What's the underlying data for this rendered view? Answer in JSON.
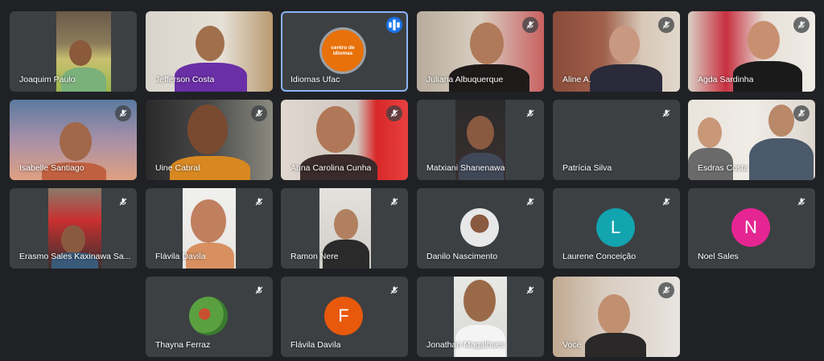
{
  "participants": [
    {
      "name": "Joaquim Paulo",
      "muted": true
    },
    {
      "name": "Jefferson Costa",
      "muted": false
    },
    {
      "name": "Idiomas Ufac",
      "muted": false,
      "speaking": true,
      "logo_text": "centro de idiomas"
    },
    {
      "name": "Juliana Albuquerque",
      "muted": true
    },
    {
      "name": "Aline A.",
      "muted": true
    },
    {
      "name": "Agda Sardinha",
      "muted": true
    },
    {
      "name": "Isabelle Santiago",
      "muted": true
    },
    {
      "name": "Uine Cabral",
      "muted": true
    },
    {
      "name": "Anna Carolina Cunha",
      "muted": true
    },
    {
      "name": "Matxiani Shanenawa",
      "muted": true
    },
    {
      "name": "Patrícia Silva",
      "muted": true
    },
    {
      "name": "Esdras Costa",
      "muted": true
    },
    {
      "name": "Erasmo Sales Kaxinawa Sa...",
      "muted": true
    },
    {
      "name": "Flávila Davila",
      "muted": true
    },
    {
      "name": "Ramon Nere",
      "muted": true
    },
    {
      "name": "Danilo Nascimento",
      "muted": true
    },
    {
      "name": "Laurene Conceição",
      "muted": true,
      "avatar_letter": "L",
      "avatar_color": "#12a4af"
    },
    {
      "name": "Noel Sales",
      "muted": true,
      "avatar_letter": "N",
      "avatar_color": "#e52592"
    },
    {
      "name": "Thayna Ferraz",
      "muted": true
    },
    {
      "name": "Flávila Davila",
      "muted": true,
      "avatar_letter": "F",
      "avatar_color": "#e8590c"
    },
    {
      "name": "Jonathan Magalhaes",
      "muted": true
    },
    {
      "name": "Você",
      "muted": true
    }
  ],
  "colors": {
    "background": "#202124",
    "tile": "#3c4043",
    "speaking_border": "#8ab4f8"
  }
}
